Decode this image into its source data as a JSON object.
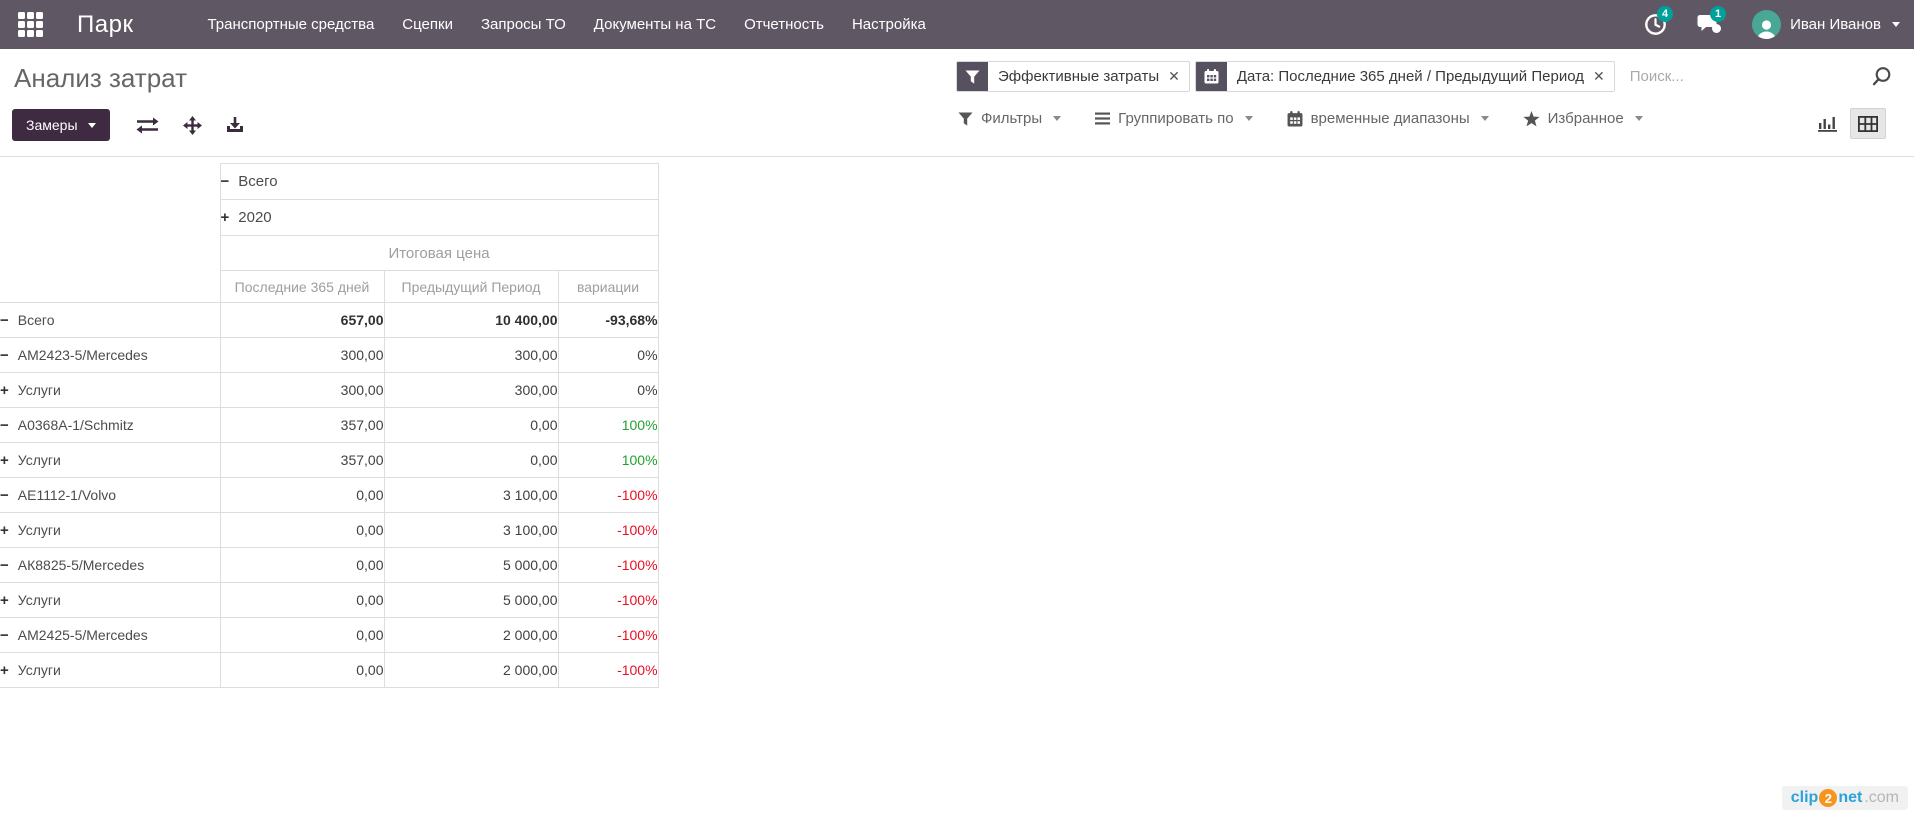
{
  "navbar": {
    "brand": "Парк",
    "items": [
      "Транспортные средства",
      "Сцепки",
      "Запросы ТО",
      "Документы на ТС",
      "Отчетность",
      "Настройка"
    ],
    "systray": {
      "activities_count": "4",
      "messages_count": "1",
      "user_name": "Иван Иванов"
    }
  },
  "breadcrumb": {
    "title": "Анализ затрат"
  },
  "search": {
    "facets": [
      {
        "icon": "filter-icon",
        "label": "Эффективные затраты",
        "remove": "✕"
      },
      {
        "icon": "calendar-icon",
        "label": "Дата: Последние 365 дней / Предыдущий Период",
        "remove": "✕"
      }
    ],
    "placeholder": "Поиск..."
  },
  "control_panel": {
    "measures_button": "Замеры",
    "menus": [
      {
        "icon": "filter-icon",
        "label": "Фильтры"
      },
      {
        "icon": "bars-icon",
        "label": "Группировать по"
      },
      {
        "icon": "calendar-icon",
        "label": "временные диапазоны"
      },
      {
        "icon": "star-icon",
        "label": "Избранное"
      }
    ]
  },
  "pivot": {
    "col_headers": [
      {
        "toggle": "−",
        "label": "Всего"
      },
      {
        "toggle": "+",
        "label": "2020"
      }
    ],
    "measure_label": "Итоговая цена",
    "sub_columns": [
      "Последние 365 дней",
      "Предыдущий Период",
      "вариации"
    ],
    "rows": [
      {
        "level": 0,
        "toggle": "−",
        "label": "Всего",
        "current": "657,00",
        "previous": "10 400,00",
        "variation": "-93,68%",
        "tone": "neg",
        "bold": true
      },
      {
        "level": 1,
        "toggle": "−",
        "label": "АМ2423-5/Mercedes",
        "current": "300,00",
        "previous": "300,00",
        "variation": "0%",
        "tone": "zero"
      },
      {
        "level": 2,
        "toggle": "+",
        "label": "Услуги",
        "current": "300,00",
        "previous": "300,00",
        "variation": "0%",
        "tone": "zero"
      },
      {
        "level": 1,
        "toggle": "−",
        "label": "А0368А-1/Schmitz",
        "current": "357,00",
        "previous": "0,00",
        "variation": "100%",
        "tone": "pos"
      },
      {
        "level": 2,
        "toggle": "+",
        "label": "Услуги",
        "current": "357,00",
        "previous": "0,00",
        "variation": "100%",
        "tone": "pos"
      },
      {
        "level": 1,
        "toggle": "−",
        "label": "АЕ1112-1/Volvo",
        "current": "0,00",
        "previous": "3 100,00",
        "variation": "-100%",
        "tone": "neg"
      },
      {
        "level": 2,
        "toggle": "+",
        "label": "Услуги",
        "current": "0,00",
        "previous": "3 100,00",
        "variation": "-100%",
        "tone": "neg"
      },
      {
        "level": 1,
        "toggle": "−",
        "label": "АК8825-5/Mercedes",
        "current": "0,00",
        "previous": "5 000,00",
        "variation": "-100%",
        "tone": "neg"
      },
      {
        "level": 2,
        "toggle": "+",
        "label": "Услуги",
        "current": "0,00",
        "previous": "5 000,00",
        "variation": "-100%",
        "tone": "neg"
      },
      {
        "level": 1,
        "toggle": "−",
        "label": "АМ2425-5/Mercedes",
        "current": "0,00",
        "previous": "2 000,00",
        "variation": "-100%",
        "tone": "neg"
      },
      {
        "level": 2,
        "toggle": "+",
        "label": "Услуги",
        "current": "0,00",
        "previous": "2 000,00",
        "variation": "-100%",
        "tone": "neg"
      }
    ]
  },
  "colors": {
    "navbar_bg": "#5f5864",
    "primary_button_bg": "#3e2a41",
    "badge_teal": "#00a09a",
    "negative_red": "#eb0e23",
    "positive_green": "#21a02e",
    "table_border": "#dddddd"
  },
  "watermark": {
    "clip": "clip",
    "two": "2",
    "net": "net",
    "com": ".com"
  }
}
